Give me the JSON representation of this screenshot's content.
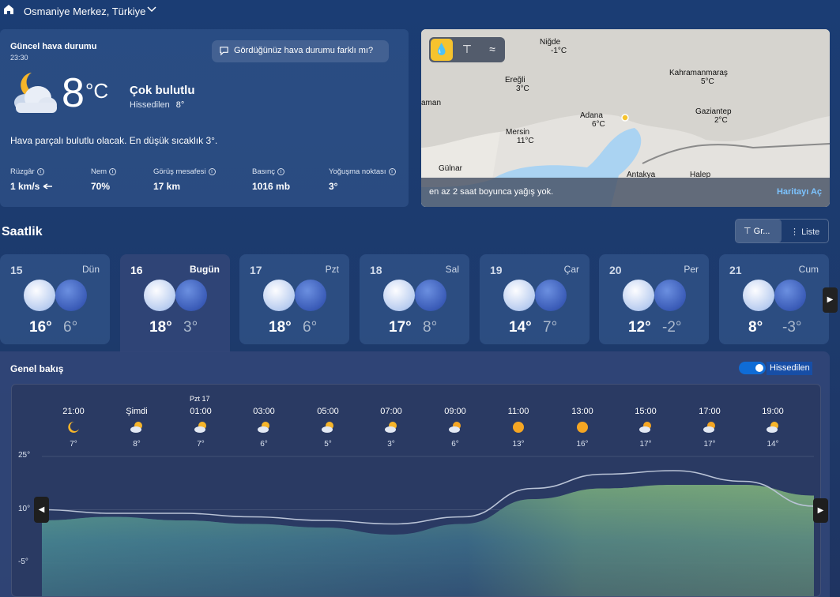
{
  "header": {
    "location": "Osmaniye Merkez, Türkiye"
  },
  "current": {
    "title": "Güncel hava durumu",
    "time": "23:30",
    "feedback": "Gördüğünüz hava durumu farklı mı?",
    "temp": "8",
    "unit": "°C",
    "condition": "Çok bulutlu",
    "feels_label": "Hissedilen",
    "feels_value": "8°",
    "summary": "Hava parçalı bulutlu olacak. En düşük sıcaklık 3°.",
    "stats": [
      {
        "label": "Rüzgâr",
        "value": "1 km/s"
      },
      {
        "label": "Nem",
        "value": "70%"
      },
      {
        "label": "Görüş mesafesi",
        "value": "17 km"
      },
      {
        "label": "Basınç",
        "value": "1016 mb"
      },
      {
        "label": "Yoğuşma noktası",
        "value": "3°"
      }
    ]
  },
  "map": {
    "note": "en az 2 saat boyunca yağış yok.",
    "open": "Haritayı Aç",
    "cities": [
      {
        "name": "Niğde",
        "temp": "-1°C"
      },
      {
        "name": "Ereğli",
        "temp": "3°C"
      },
      {
        "name": "Kahramanmaraş",
        "temp": "5°C"
      },
      {
        "name": "Adana",
        "temp": "6°C"
      },
      {
        "name": "Gaziantep",
        "temp": "2°C"
      },
      {
        "name": "Mersin",
        "temp": "11°C"
      },
      {
        "name": "Gülnar",
        "temp": ""
      },
      {
        "name": "Antakya",
        "temp": ""
      },
      {
        "name": "Halep",
        "temp": ""
      },
      {
        "name": "aman",
        "temp": ""
      }
    ]
  },
  "hourly_section": {
    "title": "Saatlik",
    "graph_label": "Gr...",
    "list_label": "Liste"
  },
  "days": [
    {
      "num": "15",
      "name": "Dün",
      "hi": "16°",
      "lo": "6°"
    },
    {
      "num": "16",
      "name": "Bugün",
      "hi": "18°",
      "lo": "3°"
    },
    {
      "num": "17",
      "name": "Pzt",
      "hi": "18°",
      "lo": "6°"
    },
    {
      "num": "18",
      "name": "Sal",
      "hi": "17°",
      "lo": "8°"
    },
    {
      "num": "19",
      "name": "Çar",
      "hi": "14°",
      "lo": "7°"
    },
    {
      "num": "20",
      "name": "Per",
      "hi": "12°",
      "lo": "-2°"
    },
    {
      "num": "21",
      "name": "Cum",
      "hi": "8°",
      "lo": "-3°"
    }
  ],
  "overview": {
    "title": "Genel bakış",
    "toggle_label": "Hissedilen",
    "date_marker": "Pzt 17",
    "hours": [
      {
        "time": "21:00",
        "temp": "7°",
        "icon": "moon-icon"
      },
      {
        "time": "Şimdi",
        "temp": "8°",
        "icon": "cloud-moon-icon"
      },
      {
        "time": "01:00",
        "temp": "7°",
        "icon": "cloud-moon-icon"
      },
      {
        "time": "03:00",
        "temp": "6°",
        "icon": "cloud-moon-icon"
      },
      {
        "time": "05:00",
        "temp": "5°",
        "icon": "cloud-moon-icon"
      },
      {
        "time": "07:00",
        "temp": "3°",
        "icon": "cloud-moon-icon"
      },
      {
        "time": "09:00",
        "temp": "6°",
        "icon": "cloud-sun-icon"
      },
      {
        "time": "11:00",
        "temp": "13°",
        "icon": "sun-icon"
      },
      {
        "time": "13:00",
        "temp": "16°",
        "icon": "sun-icon"
      },
      {
        "time": "15:00",
        "temp": "17°",
        "icon": "cloud-sun-icon"
      },
      {
        "time": "17:00",
        "temp": "17°",
        "icon": "cloud-sun-icon"
      },
      {
        "time": "19:00",
        "temp": "14°",
        "icon": "cloud-moon-icon"
      }
    ],
    "y_ticks": [
      "25°",
      "10°",
      "-5°"
    ]
  },
  "chart_data": {
    "type": "area",
    "x": [
      "21:00",
      "Şimdi",
      "01:00",
      "03:00",
      "05:00",
      "07:00",
      "09:00",
      "11:00",
      "13:00",
      "15:00",
      "17:00",
      "19:00"
    ],
    "ylim": [
      -10,
      30
    ],
    "series": [
      {
        "values": [
          7,
          8,
          7,
          6,
          5,
          3,
          6,
          13,
          16,
          17,
          17,
          14
        ]
      },
      {
        "values": [
          10,
          9,
          9,
          8,
          7,
          6,
          8,
          16,
          20,
          21,
          18,
          11
        ]
      }
    ]
  }
}
